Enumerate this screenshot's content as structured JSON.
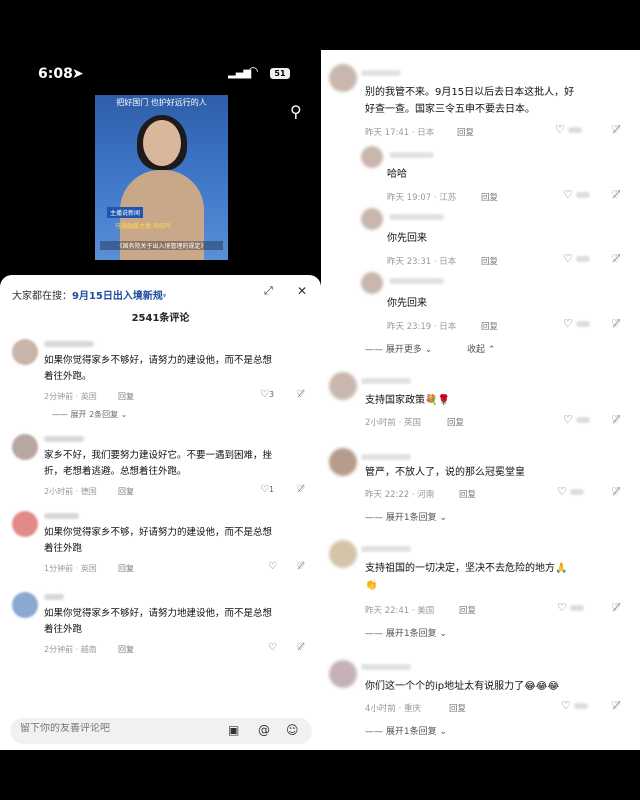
{
  "status_bar": {
    "time": "6:08",
    "battery": "51"
  },
  "video": {
    "headline": "把好国门 也护好远行的人",
    "tag": "主播说新闻",
    "anchor_name": "马海融媒主播 冉晓丹",
    "caption": "《国务院关于出入境管理的规定》"
  },
  "sheet": {
    "hot_search_label": "大家都在搜：",
    "hot_search_query": "9月15日出入境新规",
    "comment_count": "2541条评论",
    "input_placeholder": "留下你的友善评论吧"
  },
  "left_comments": [
    {
      "text_lines": [
        "如果你觉得家乡不够好，请努力的建设他，而不是总想",
        "着往外跑。"
      ],
      "meta": "2分钟前 · 英国",
      "reply": "回复",
      "likes": "3",
      "more": "展开 2条回复"
    },
    {
      "text_lines": [
        "家乡不好，我们要努力建设好它。不要一遇到困难，挫",
        "折，老想着逃避。总想着往外跑。"
      ],
      "meta": "2小时前 · 德国",
      "reply": "回复",
      "likes": "1",
      "more": ""
    },
    {
      "text_lines": [
        "如果你觉得家乡不够，好请努力的建设他，而不是总想",
        "着往外跑"
      ],
      "meta": "1分钟前 · 英国",
      "reply": "回复",
      "likes": "",
      "more": ""
    },
    {
      "text_lines": [
        "如果你觉得家乡不够好，请努力地建设他，而不是总想",
        "着往外跑"
      ],
      "meta": "2分钟前 · 越南",
      "reply": "回复",
      "likes": "",
      "more": ""
    }
  ],
  "right_comments": [
    {
      "text_lines": [
        "别的我管不来。9月15日以后去日本这批人，好",
        "好查一查。国家三令五申不要去日本。"
      ],
      "meta": "昨天 17:41 · 日本",
      "reply": "回复"
    },
    {
      "text_lines": [
        "哈哈"
      ],
      "meta": "昨天 19:07 · 江苏",
      "reply": "回复"
    },
    {
      "text_lines": [
        "你先回来"
      ],
      "meta": "昨天 23:31 · 日本",
      "reply": "回复"
    },
    {
      "text_lines": [
        "你先回来"
      ],
      "meta": "昨天 23:19 · 日本",
      "reply": "回复"
    },
    {
      "text_lines": [
        "支持国家政策💐🌹"
      ],
      "meta": "2小时前 · 英国",
      "reply": "回复"
    },
    {
      "text_lines": [
        "管严，不放人了，说的那么冠冕堂皇"
      ],
      "meta": "昨天 22:22 · 河南",
      "reply": "回复"
    },
    {
      "text_lines": [
        "支持祖国的一切决定，坚决不去危险的地方🙏",
        "👏"
      ],
      "meta": "昨天 22:41 · 美国",
      "reply": "回复"
    },
    {
      "text_lines": [
        "你们这一个个的ip地址太有说服力了😂😂😂"
      ],
      "meta": "4小时前 · 重庆",
      "reply": "回复"
    }
  ],
  "right_controls": {
    "expand_more": "展开更多",
    "collapse": "收起",
    "expand_one": "展开1条回复"
  }
}
